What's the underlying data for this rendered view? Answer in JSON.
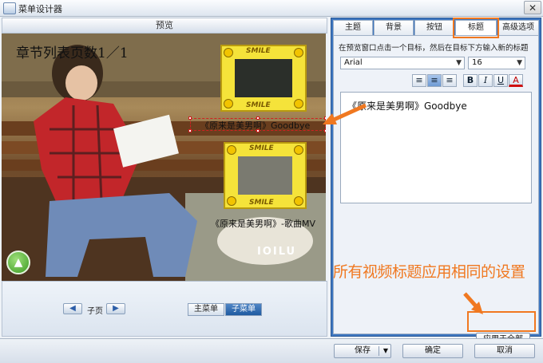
{
  "window": {
    "title": "菜单设计器",
    "close_glyph": "✕"
  },
  "preview": {
    "header": "预览",
    "page_title": "章节列表页数1／1",
    "chapters": [
      {
        "title": "《原来是美男啊》Goodbye",
        "thumb_label": "SMILE"
      },
      {
        "title": "《原来是美男啊》-歌曲MV",
        "thumb_label": "SMILE"
      }
    ],
    "watermark": "IOILU",
    "up_glyph": "▲",
    "subpage": {
      "prev_glyph": "◀",
      "label": "子页",
      "next_glyph": "▶"
    },
    "menu_tabs": {
      "main": "主菜单",
      "sub": "子菜单"
    }
  },
  "settings": {
    "tabs": [
      "主题",
      "背景",
      "按钮",
      "标题",
      "高级选项"
    ],
    "active_tab": "标题",
    "instruction": "在预览窗口点击一个目标，然后在目标下方输入新的标题",
    "font": "Arial",
    "size": "16",
    "format_buttons": [
      {
        "icon": "align-left-icon",
        "glyph": "≡"
      },
      {
        "icon": "align-center-icon",
        "glyph": "≡"
      },
      {
        "icon": "align-right-icon",
        "glyph": "≡"
      },
      {
        "icon": "bold-icon",
        "glyph": "B"
      },
      {
        "icon": "italic-icon",
        "glyph": "I"
      },
      {
        "icon": "underline-icon",
        "glyph": "U"
      },
      {
        "icon": "text-color-icon",
        "glyph": "A"
      }
    ],
    "editor_text": "《原来是美男啊》Goodbye",
    "apply_all": "应用于全部"
  },
  "annotation": "所有视频标题应用相同的设置",
  "footer": {
    "save": "保存",
    "ok": "确定",
    "cancel": "取消"
  },
  "colors": {
    "accent": "#f07820",
    "panel_blue": "#3d76c0",
    "thumb_yellow": "#f5e33a"
  }
}
